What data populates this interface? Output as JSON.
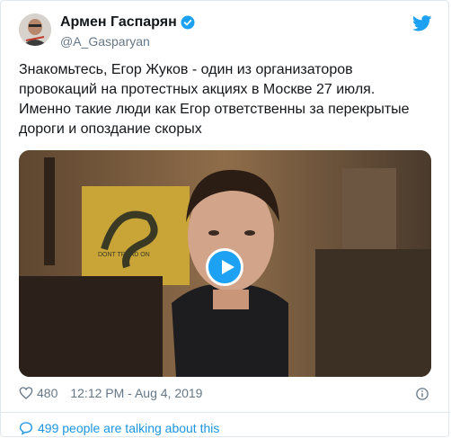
{
  "author": {
    "name": "Армен Гаспарян",
    "handle": "@A_Gasparyan",
    "verified_icon": "verified-badge-icon"
  },
  "brand_icon": "twitter-bird-icon",
  "tweet": {
    "text_lines": [
      "Знакомьтесь, Егор Жуков - один из организаторов",
      "провокаций на протестных акциях в Москве 27 июля.",
      "Именно такие люди как Егор ответственны за перекрытые",
      "дороги и опоздание скорых"
    ]
  },
  "media": {
    "type": "video",
    "play_icon": "play-icon",
    "flag_text": "DONT TREAD ON"
  },
  "footer": {
    "likes": "480",
    "timestamp": "12:12 PM - Aug 4, 2019",
    "talking": "499 people are talking about this"
  },
  "colors": {
    "accent": "#1da1f2",
    "link": "#1b95e0",
    "muted": "#657786",
    "border": "#e1e8ed"
  }
}
